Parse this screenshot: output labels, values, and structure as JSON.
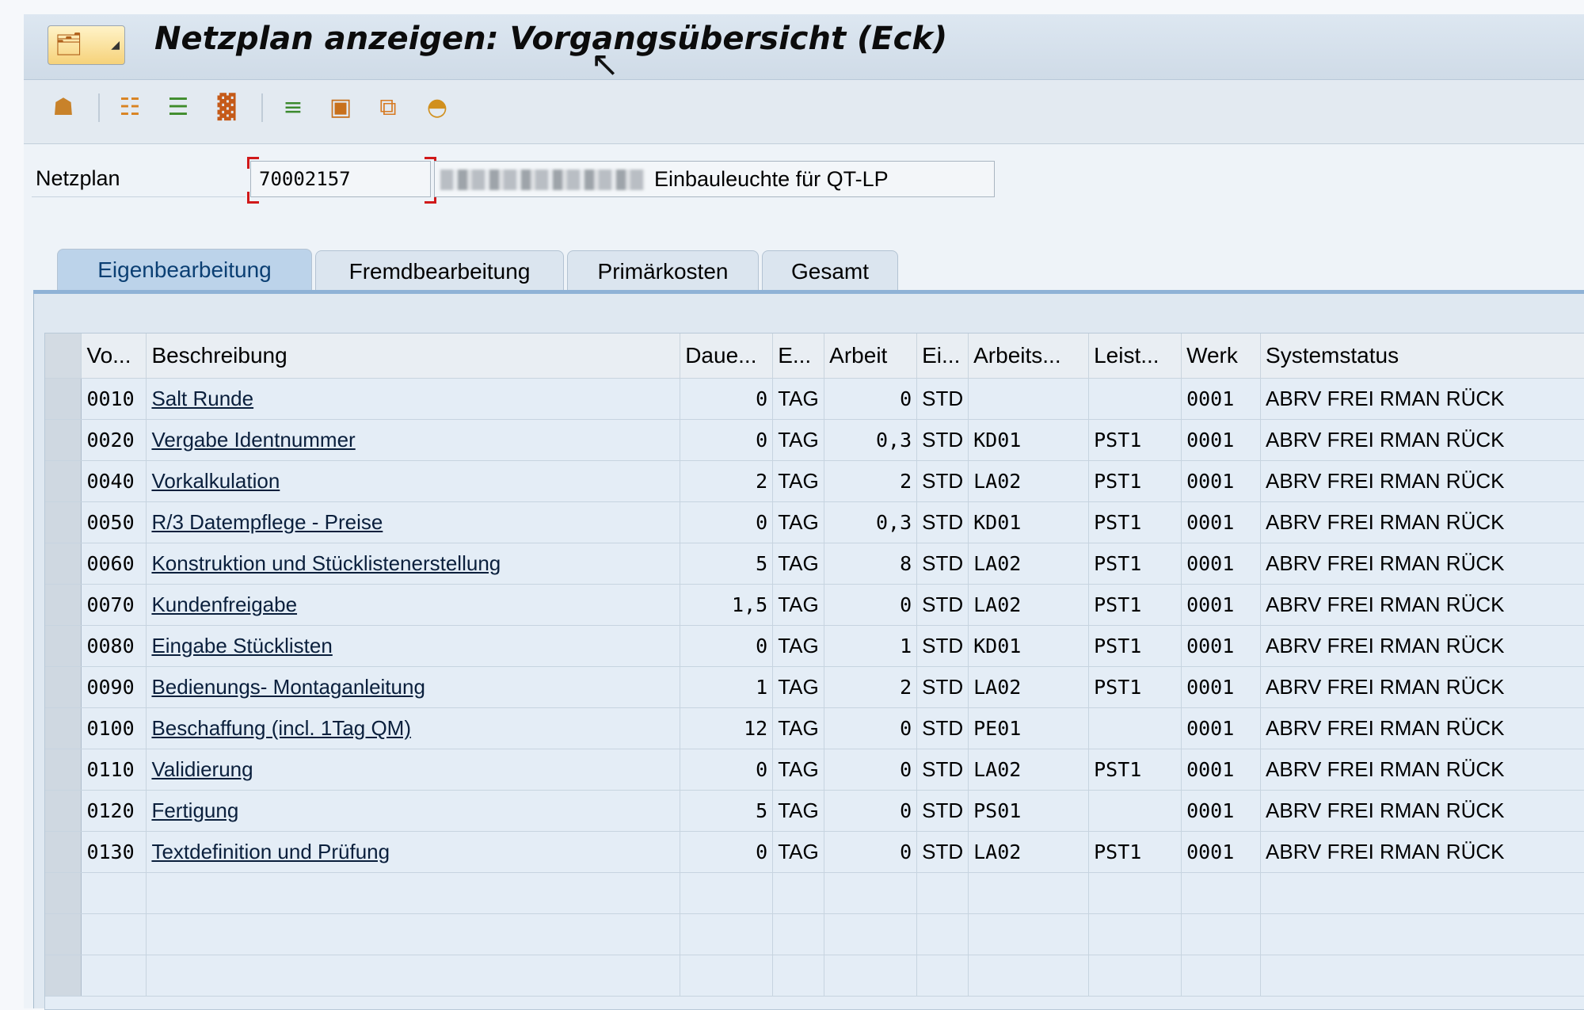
{
  "window": {
    "title": "Netzplan anzeigen: Vorgangsübersicht (Eck)"
  },
  "header": {
    "netzplan_label": "Netzplan",
    "netzplan_value": "70002157",
    "description": "Einbauleuchte für QT-LP"
  },
  "toolbar": {
    "icons": [
      "hierarchy-icon",
      "structure-icon",
      "gantt-icon",
      "chart-icon",
      "list-icon",
      "component-icon",
      "copy-icon",
      "overview-icon"
    ]
  },
  "tabs": [
    {
      "label": "Eigenbearbeitung",
      "active": true
    },
    {
      "label": "Fremdbearbeitung",
      "active": false
    },
    {
      "label": "Primärkosten",
      "active": false
    },
    {
      "label": "Gesamt",
      "active": false
    }
  ],
  "table": {
    "columns": [
      "Vo...",
      "Beschreibung",
      "Daue...",
      "E...",
      "Arbeit",
      "Ei...",
      "Arbeits...",
      "Leist...",
      "Werk",
      "Systemstatus"
    ],
    "rows": [
      [
        "0010",
        "Salt Runde",
        "0",
        "TAG",
        "0",
        "STD",
        "",
        "",
        "0001",
        "ABRV FREI RMAN RÜCK"
      ],
      [
        "0020",
        "Vergabe Identnummer",
        "0",
        "TAG",
        "0,3",
        "STD",
        "KD01",
        "PST1",
        "0001",
        "ABRV FREI RMAN RÜCK"
      ],
      [
        "0040",
        "Vorkalkulation",
        "2",
        "TAG",
        "2",
        "STD",
        "LA02",
        "PST1",
        "0001",
        "ABRV FREI RMAN RÜCK"
      ],
      [
        "0050",
        "R/3 Datempflege - Preise",
        "0",
        "TAG",
        "0,3",
        "STD",
        "KD01",
        "PST1",
        "0001",
        "ABRV FREI RMAN RÜCK"
      ],
      [
        "0060",
        "Konstruktion und Stücklistenerstellung",
        "5",
        "TAG",
        "8",
        "STD",
        "LA02",
        "PST1",
        "0001",
        "ABRV FREI RMAN RÜCK"
      ],
      [
        "0070",
        "Kundenfreigabe",
        "1,5",
        "TAG",
        "0",
        "STD",
        "LA02",
        "PST1",
        "0001",
        "ABRV FREI RMAN RÜCK"
      ],
      [
        "0080",
        "Eingabe Stücklisten",
        "0",
        "TAG",
        "1",
        "STD",
        "KD01",
        "PST1",
        "0001",
        "ABRV FREI RMAN RÜCK"
      ],
      [
        "0090",
        "Bedienungs- Montaganleitung",
        "1",
        "TAG",
        "2",
        "STD",
        "LA02",
        "PST1",
        "0001",
        "ABRV FREI RMAN RÜCK"
      ],
      [
        "0100",
        "Beschaffung (incl. 1Tag QM)",
        "12",
        "TAG",
        "0",
        "STD",
        "PE01",
        "",
        "0001",
        "ABRV FREI RMAN RÜCK"
      ],
      [
        "0110",
        "Validierung",
        "0",
        "TAG",
        "0",
        "STD",
        "LA02",
        "PST1",
        "0001",
        "ABRV FREI RMAN RÜCK"
      ],
      [
        "0120",
        "Fertigung",
        "5",
        "TAG",
        "0",
        "STD",
        "PS01",
        "",
        "0001",
        "ABRV FREI RMAN RÜCK"
      ],
      [
        "0130",
        "Textdefinition und Prüfung",
        "0",
        "TAG",
        "0",
        "STD",
        "LA02",
        "PST1",
        "0001",
        "ABRV FREI RMAN RÜCK"
      ]
    ],
    "empty_rows": 3
  },
  "colors": {
    "accent": "#8fb2d6",
    "active_tab": "#bcd3ea",
    "grid_bg": "#e4edf6"
  }
}
